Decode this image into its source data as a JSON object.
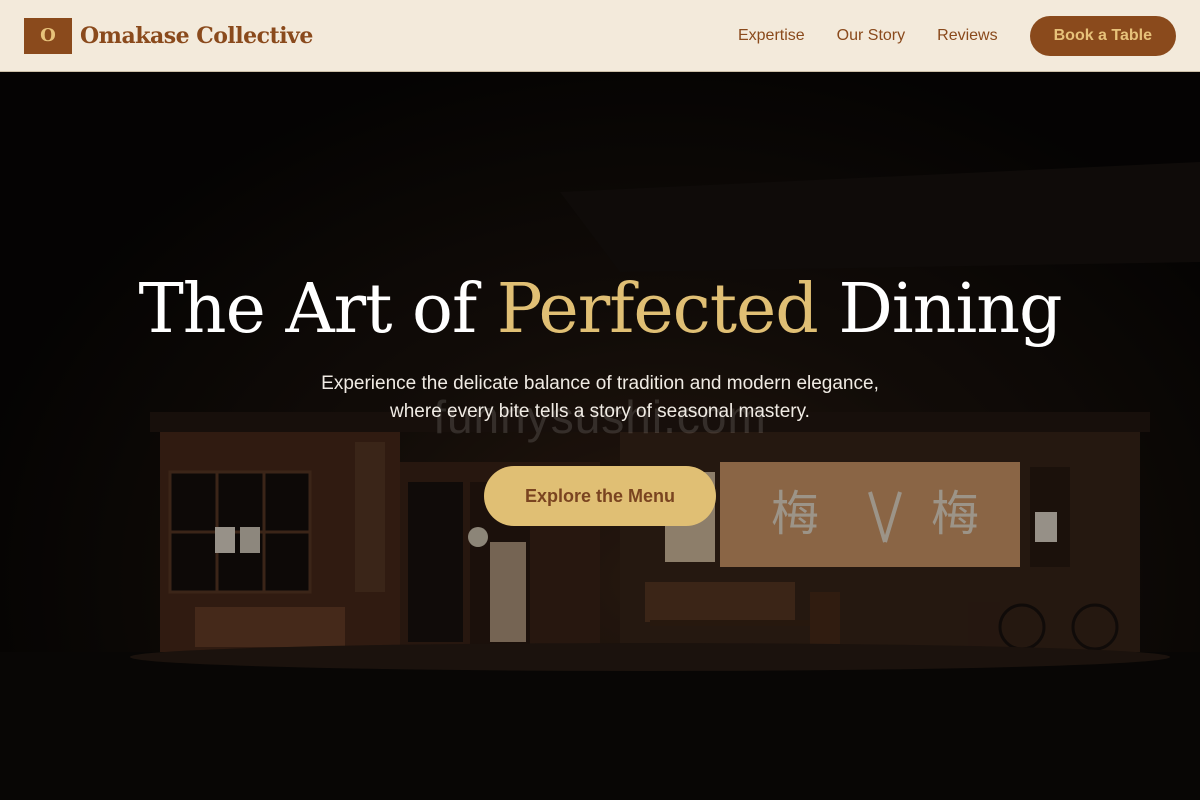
{
  "header": {
    "logo_letter": "O",
    "brand_name": "Omakase Collective",
    "nav": [
      "Expertise",
      "Our Story",
      "Reviews"
    ],
    "book_label": "Book a Table"
  },
  "hero": {
    "headline_before": "The Art of ",
    "headline_accent": "Perfected",
    "headline_after": " Dining",
    "subtitle_line1": "Experience the delicate balance of tradition and modern elegance,",
    "subtitle_line2": "where every bite tells a story of seasonal mastery.",
    "cta_label": "Explore the Menu",
    "watermark": "funnysushi.com",
    "sign_text": "梅"
  },
  "colors": {
    "brand_brown": "#8a4a1c",
    "accent_gold": "#e0bf74",
    "header_bg": "#f3eadb"
  }
}
